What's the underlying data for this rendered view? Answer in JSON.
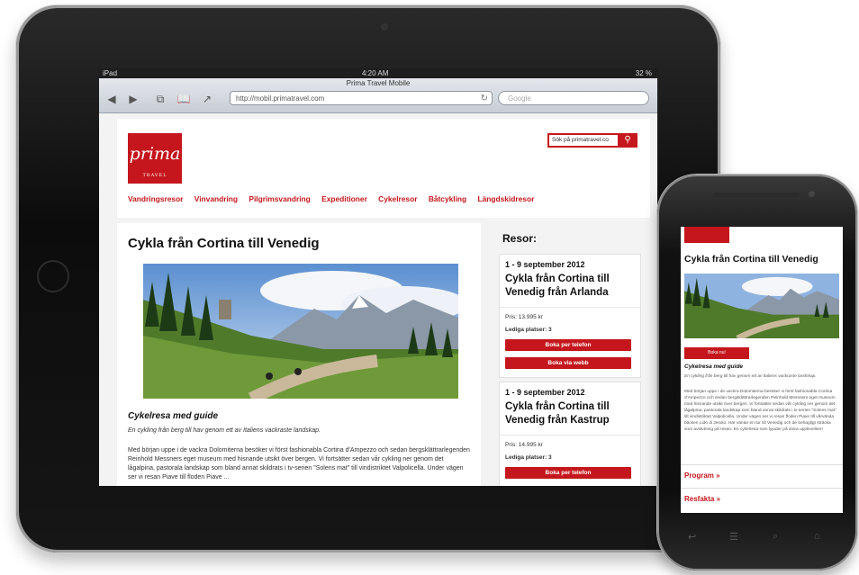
{
  "tablet": {
    "status": {
      "carrier": "iPad",
      "time": "4:20 AM",
      "battery": "32 %"
    },
    "browser": {
      "title": "Prima Travel Mobile",
      "url": "http://mobil.primatravel.com",
      "search_placeholder": "Google"
    },
    "site": {
      "logo_text": "prima",
      "logo_sub": "TRAVEL",
      "search_placeholder": "Sök på primatravel.co",
      "nav": [
        "Vandringsresor",
        "Vinvandring",
        "Pilgrimsvandring",
        "Expeditioner",
        "Cykelresor",
        "Båtcykling",
        "Längdskidresor"
      ],
      "article": {
        "title": "Cykla från Cortina till Venedig",
        "subtitle": "Cykelresa med guide",
        "lead": "En cykling från berg till hav genom ett av Italiens vackraste landskap.",
        "body": "Med början uppe i de vackra Dolomiterna besöker vi först fashionabla Cortina d'Ampezzo och sedan bergsklättrarlegenden Reinhold Messners eget museum med hisnande utsikt över bergen. Vi fortsätter sedan vår cykling ner genom det lågalpina, pastorala landskap som bland annat skildrats i tv-serien \"Solens mat\" till vindistriktet Valpolicella. Under vägen ser vi resan Piave till floden Piave ..."
      },
      "sidebar": {
        "title": "Resor:",
        "trips": [
          {
            "date": "1 - 9 september 2012",
            "name": "Cykla från Cortina till Venedig från Arlanda",
            "price": "Pris: 13.995 kr",
            "seats": "Lediga platser: 3",
            "btn_phone": "Boka per telefon",
            "btn_web": "Boka via webb"
          },
          {
            "date": "1 - 9 september 2012",
            "name": "Cykla från Cortina till Venedig från Kastrup",
            "price": "Pris: 14.995 kr",
            "seats": "Lediga platser: 3",
            "btn_phone": "Boka per telefon"
          }
        ]
      }
    }
  },
  "phone": {
    "title": "Cykla från Cortina till Venedig",
    "book_button": "Boka nu!",
    "subtitle": "Cykelresa med guide",
    "lead": "En cykling från berg till hav genom ett av Italiens vackraste landskap.",
    "body": "Med början uppe i de vackra Dolomiterna besöker vi först fashionabla Cortina d'Ampezzo och sedan bergsklättrarlegenden Reinhold Messners eget museum med hisnande utsikt över bergen. Vi fortsätter sedan vår cykling ner genom det lågalpina, pastorala landskap som bland annat skildrats i tv-serien \"Solens mat\" till vindistriktet Valpolicella. Under vägen ser vi resan floden Piave till vårvända bäcken Lido di Jesolo. Här väntar en tur till Venedig och de behagligt sträcka som avslutning på resan. En cykelresa som lyjuder på stora upplevelser!",
    "links": [
      "Program »",
      "Resfakta »"
    ]
  },
  "colors": {
    "brand_red": "#c4161c"
  }
}
